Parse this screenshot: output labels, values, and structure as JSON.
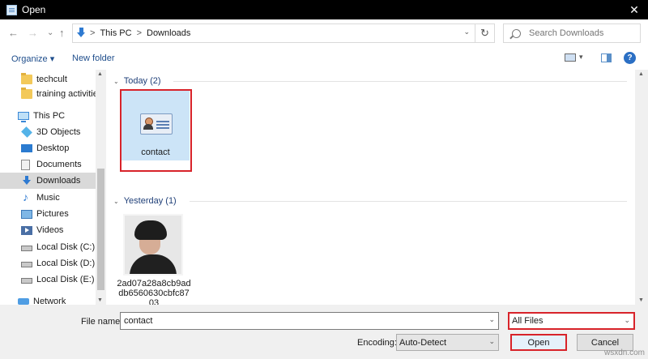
{
  "window": {
    "title": "Open",
    "close_glyph": "✕"
  },
  "address": {
    "back_glyph": "←",
    "forward_glyph": "→",
    "recent_glyph": "⌄",
    "up_glyph": "↑",
    "crumbs": [
      "This PC",
      "Downloads"
    ],
    "separator": ">",
    "dropdown_glyph": "⌄",
    "refresh_glyph": "↻"
  },
  "search": {
    "placeholder": "Search Downloads"
  },
  "toolbar": {
    "organize_label": "Organize ▾",
    "new_folder_label": "New folder",
    "view_dd_glyph": "▾",
    "help_glyph": "?"
  },
  "sidebar": {
    "items": [
      {
        "label": "techcult",
        "icon": "folder-icon"
      },
      {
        "label": "training activities",
        "icon": "folder-icon"
      },
      {
        "label": "This PC",
        "icon": "this-pc-icon"
      },
      {
        "label": "3D Objects",
        "icon": "3d-objects-icon"
      },
      {
        "label": "Desktop",
        "icon": "desktop-icon"
      },
      {
        "label": "Documents",
        "icon": "documents-icon"
      },
      {
        "label": "Downloads",
        "icon": "downloads-icon",
        "selected": true
      },
      {
        "label": "Music",
        "icon": "music-icon"
      },
      {
        "label": "Pictures",
        "icon": "pictures-icon"
      },
      {
        "label": "Videos",
        "icon": "videos-icon"
      },
      {
        "label": "Local Disk (C:)",
        "icon": "disk-icon"
      },
      {
        "label": "Local Disk (D:)",
        "icon": "disk-icon"
      },
      {
        "label": "Local Disk (E:)",
        "icon": "disk-icon"
      },
      {
        "label": "Network",
        "icon": "network-icon"
      }
    ]
  },
  "content": {
    "groups": [
      {
        "header": "Today (2)",
        "files": [
          {
            "name": "contact",
            "icon": "contact-card-icon",
            "selected": true
          }
        ]
      },
      {
        "header": "Yesterday (1)",
        "files": [
          {
            "name": "2ad07a28a8cb9addb6560630cbfc8703",
            "icon": "photo-thumbnail"
          }
        ]
      }
    ]
  },
  "bottom": {
    "file_name_label": "File name:",
    "file_name_value": "contact",
    "file_type_value": "All Files",
    "encoding_label": "Encoding:",
    "encoding_value": "Auto-Detect",
    "open_label": "Open",
    "cancel_label": "Cancel"
  },
  "watermark": "wsxdn.com",
  "colors": {
    "highlight": "#d8232a",
    "selection": "#cce4f7",
    "link": "#1f4e8c",
    "accent": "#0078d7"
  }
}
